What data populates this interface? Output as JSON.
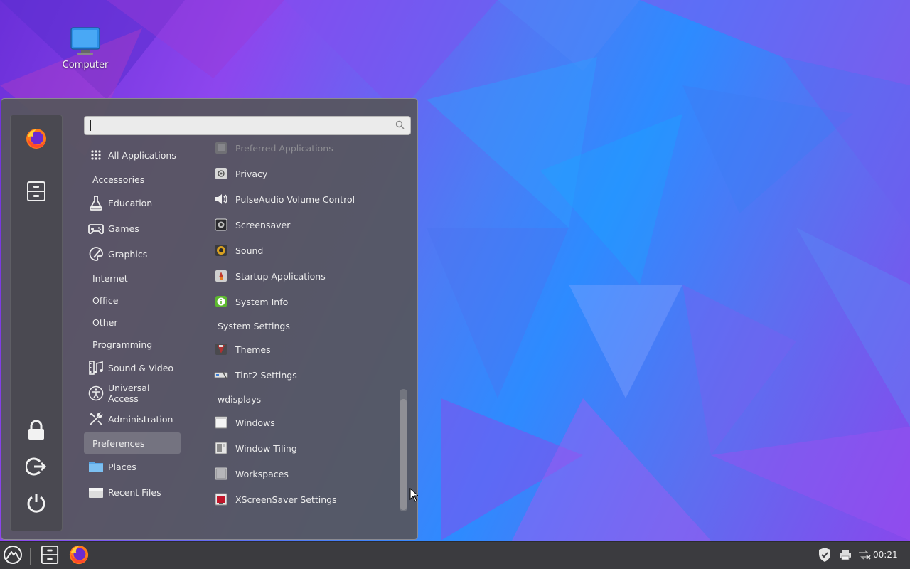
{
  "desktop": {
    "icons": [
      {
        "label": "Computer",
        "icon": "computer-icon"
      }
    ]
  },
  "menu": {
    "search": {
      "placeholder": "",
      "value": ""
    },
    "favorites": [
      {
        "name": "firefox",
        "icon": "firefox-icon"
      },
      {
        "name": "file-manager",
        "icon": "file-cabinet-icon"
      }
    ],
    "session_buttons": [
      {
        "name": "lock",
        "icon": "lock-icon"
      },
      {
        "name": "logout",
        "icon": "logout-icon"
      },
      {
        "name": "shutdown",
        "icon": "power-icon"
      }
    ],
    "categories": [
      {
        "label": "All Applications",
        "icon": "grid-icon"
      },
      {
        "label": "Accessories",
        "icon": ""
      },
      {
        "label": "Education",
        "icon": "flask-icon"
      },
      {
        "label": "Games",
        "icon": "gamepad-icon"
      },
      {
        "label": "Graphics",
        "icon": "palette-icon"
      },
      {
        "label": "Internet",
        "icon": ""
      },
      {
        "label": "Office",
        "icon": ""
      },
      {
        "label": "Other",
        "icon": ""
      },
      {
        "label": "Programming",
        "icon": ""
      },
      {
        "label": "Sound & Video",
        "icon": "film-music-icon"
      },
      {
        "label": "Universal Access",
        "icon": "accessibility-icon"
      },
      {
        "label": "Administration",
        "icon": "tools-icon"
      },
      {
        "label": "Preferences",
        "icon": "",
        "active": true
      },
      {
        "label": "Places",
        "icon": "folder-icon"
      },
      {
        "label": "Recent Files",
        "icon": "document-icon"
      }
    ],
    "apps": [
      {
        "label": "Preferred Applications",
        "icon": "preferred-apps-icon",
        "faded": true
      },
      {
        "label": "Privacy",
        "icon": "privacy-icon"
      },
      {
        "label": "PulseAudio Volume Control",
        "icon": "speaker-icon"
      },
      {
        "label": "Screensaver",
        "icon": "screensaver-icon"
      },
      {
        "label": "Sound",
        "icon": "sound-icon"
      },
      {
        "label": "Startup Applications",
        "icon": "startup-icon"
      },
      {
        "label": "System Info",
        "icon": "info-icon"
      },
      {
        "label": "System Settings",
        "icon": ""
      },
      {
        "label": "Themes",
        "icon": "themes-icon"
      },
      {
        "label": "Tint2 Settings",
        "icon": "tint2-icon"
      },
      {
        "label": "wdisplays",
        "icon": ""
      },
      {
        "label": "Windows",
        "icon": "windows-icon"
      },
      {
        "label": "Window Tiling",
        "icon": "window-tiling-icon"
      },
      {
        "label": "Workspaces",
        "icon": "workspaces-icon"
      },
      {
        "label": "XScreenSaver Settings",
        "icon": "xscreensaver-icon"
      }
    ]
  },
  "taskbar": {
    "launchers": [
      {
        "name": "menu",
        "icon": "cinnamon-logo-icon"
      },
      {
        "name": "file-manager",
        "icon": "file-cabinet-icon"
      },
      {
        "name": "firefox",
        "icon": "firefox-icon"
      }
    ],
    "tray": [
      {
        "name": "update-shield",
        "icon": "shield-check-icon"
      },
      {
        "name": "printer",
        "icon": "printer-icon"
      },
      {
        "name": "network",
        "icon": "network-disconnected-icon"
      }
    ],
    "clock": "00:21"
  },
  "colors": {
    "menu_bg": "#56565c",
    "active_category": "#8c8c96",
    "taskbar_bg": "#3b3b3f",
    "text": "#ececec"
  }
}
